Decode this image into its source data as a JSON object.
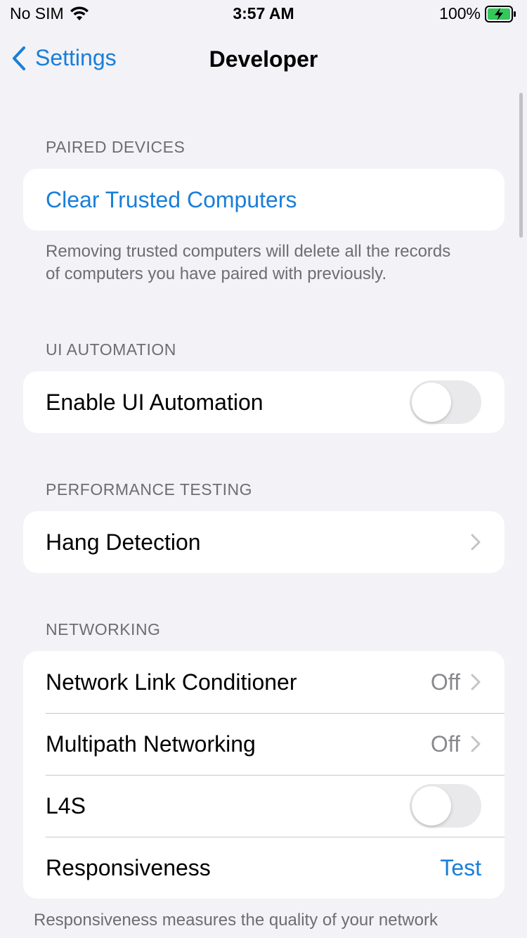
{
  "status_bar": {
    "carrier": "No SIM",
    "time": "3:57 AM",
    "battery": "100%"
  },
  "nav": {
    "back_label": "Settings",
    "title": "Developer"
  },
  "paired_devices": {
    "header": "PAIRED DEVICES",
    "clear_label": "Clear Trusted Computers",
    "footer": "Removing trusted computers will delete all the records of computers you have paired with previously."
  },
  "ui_automation": {
    "header": "UI AUTOMATION",
    "enable_label": "Enable UI Automation",
    "enabled": false
  },
  "performance_testing": {
    "header": "PERFORMANCE TESTING",
    "hang_label": "Hang Detection"
  },
  "networking": {
    "header": "NETWORKING",
    "link_conditioner_label": "Network Link Conditioner",
    "link_conditioner_value": "Off",
    "multipath_label": "Multipath Networking",
    "multipath_value": "Off",
    "l4s_label": "L4S",
    "l4s_enabled": false,
    "responsiveness_label": "Responsiveness",
    "responsiveness_action": "Test",
    "footer": "Responsiveness measures the quality of your network"
  },
  "colors": {
    "accent": "#1a7ed8",
    "background": "#f2f2f7",
    "battery": "#34c759"
  }
}
